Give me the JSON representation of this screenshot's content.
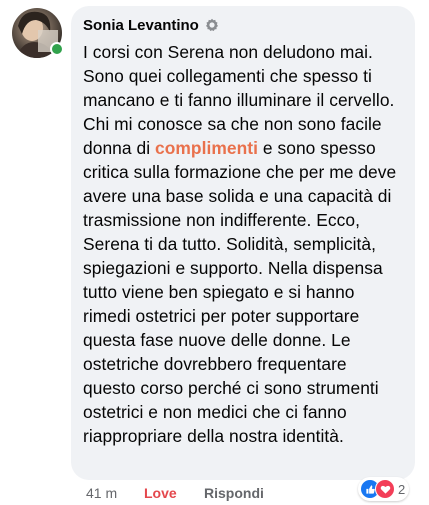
{
  "comment": {
    "author": "Sonia Levantino",
    "author_badge_icon": "gear-badge-icon",
    "text_before": "I corsi con Serena non deludono mai. Sono quei collegamenti che spesso ti mancano e ti fanno illuminare il cervello. Chi mi conosce sa che non sono facile donna di ",
    "text_highlight": "complimenti",
    "text_after": " e sono spesso critica sulla formazione che per me deve avere una base solida e una capacità di trasmissione non indifferente. Ecco, Serena ti da tutto. Solidità, semplicità, spiegazioni e supporto. Nella dispensa tutto viene ben spiegato e si hanno rimedi ostetrici per poter supportare questa fase nuove delle donne. Le ostetriche dovrebbero frequentare questo corso perché ci sono strumenti ostetrici e non medici che ci fanno riappropriare della nostra identità.",
    "highlight_color": "#e9714c"
  },
  "actions": {
    "time": "41 m",
    "love_label": "Love",
    "reply_label": "Rispondi"
  },
  "reactions": {
    "icons": [
      "like-icon",
      "love-icon"
    ],
    "count": "2"
  },
  "colors": {
    "bubble": "#f0f2f5",
    "love": "#e4474c",
    "online": "#31a24c",
    "like": "#1877f2"
  }
}
